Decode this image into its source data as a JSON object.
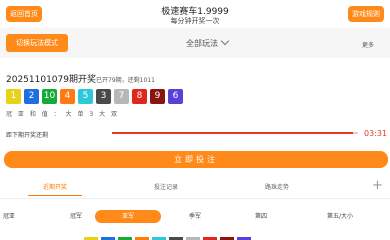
{
  "header": {
    "left_btn": "返回首页",
    "title": "极速赛车1.9999",
    "subtitle": "每分钟开奖一次",
    "right_btn": "游戏规则"
  },
  "toolbar": {
    "left_btn": "切换玩法模式",
    "center_select": "全部玩法",
    "right_menu": "更多"
  },
  "issue": {
    "number": "20251101079",
    "label": "期开奖",
    "detail": "已开79期，还剩1011"
  },
  "balls": [
    {
      "n": "1",
      "color": "#e8d31a"
    },
    {
      "n": "2",
      "color": "#1f6fe0"
    },
    {
      "n": "10",
      "color": "#19a83a"
    },
    {
      "n": "4",
      "color": "#ff7a12"
    },
    {
      "n": "5",
      "color": "#2ec9d8"
    },
    {
      "n": "3",
      "color": "#4a4a4a"
    },
    {
      "n": "7",
      "color": "#b7b7b7"
    },
    {
      "n": "8",
      "color": "#e0271b"
    },
    {
      "n": "9",
      "color": "#8a1410"
    },
    {
      "n": "6",
      "color": "#5a3fd9"
    }
  ],
  "stats": "冠 亚 和 值 ： 大 单 3 大 双",
  "countdown": {
    "label": "距下期开奖还剩",
    "time": "03:31",
    "progress": 0.98
  },
  "main_button": "立即投注",
  "tabs": [
    {
      "label": "近期开奖",
      "active": true
    },
    {
      "label": "投注记录",
      "active": false
    },
    {
      "label": "路珠走势",
      "active": false
    }
  ],
  "plus_icon": "plus-icon",
  "chips": [
    {
      "label": "冠亚",
      "active": false
    },
    {
      "label": "冠军",
      "active": false
    },
    {
      "label": "亚军",
      "active": true
    },
    {
      "label": "季军",
      "active": false
    },
    {
      "label": "第四",
      "active": false
    },
    {
      "label": "第五/大小",
      "active": false
    }
  ],
  "bottom_swatches": [
    "#e8d31a",
    "#1f6fe0",
    "#19a83a",
    "#ff7a12",
    "#2ec9d8",
    "#4a4a4a",
    "#b7b7b7",
    "#e0271b",
    "#8a1410",
    "#5a3fd9"
  ],
  "colors": {
    "accent": "#ff8a1a",
    "timer": "#e53a26"
  }
}
